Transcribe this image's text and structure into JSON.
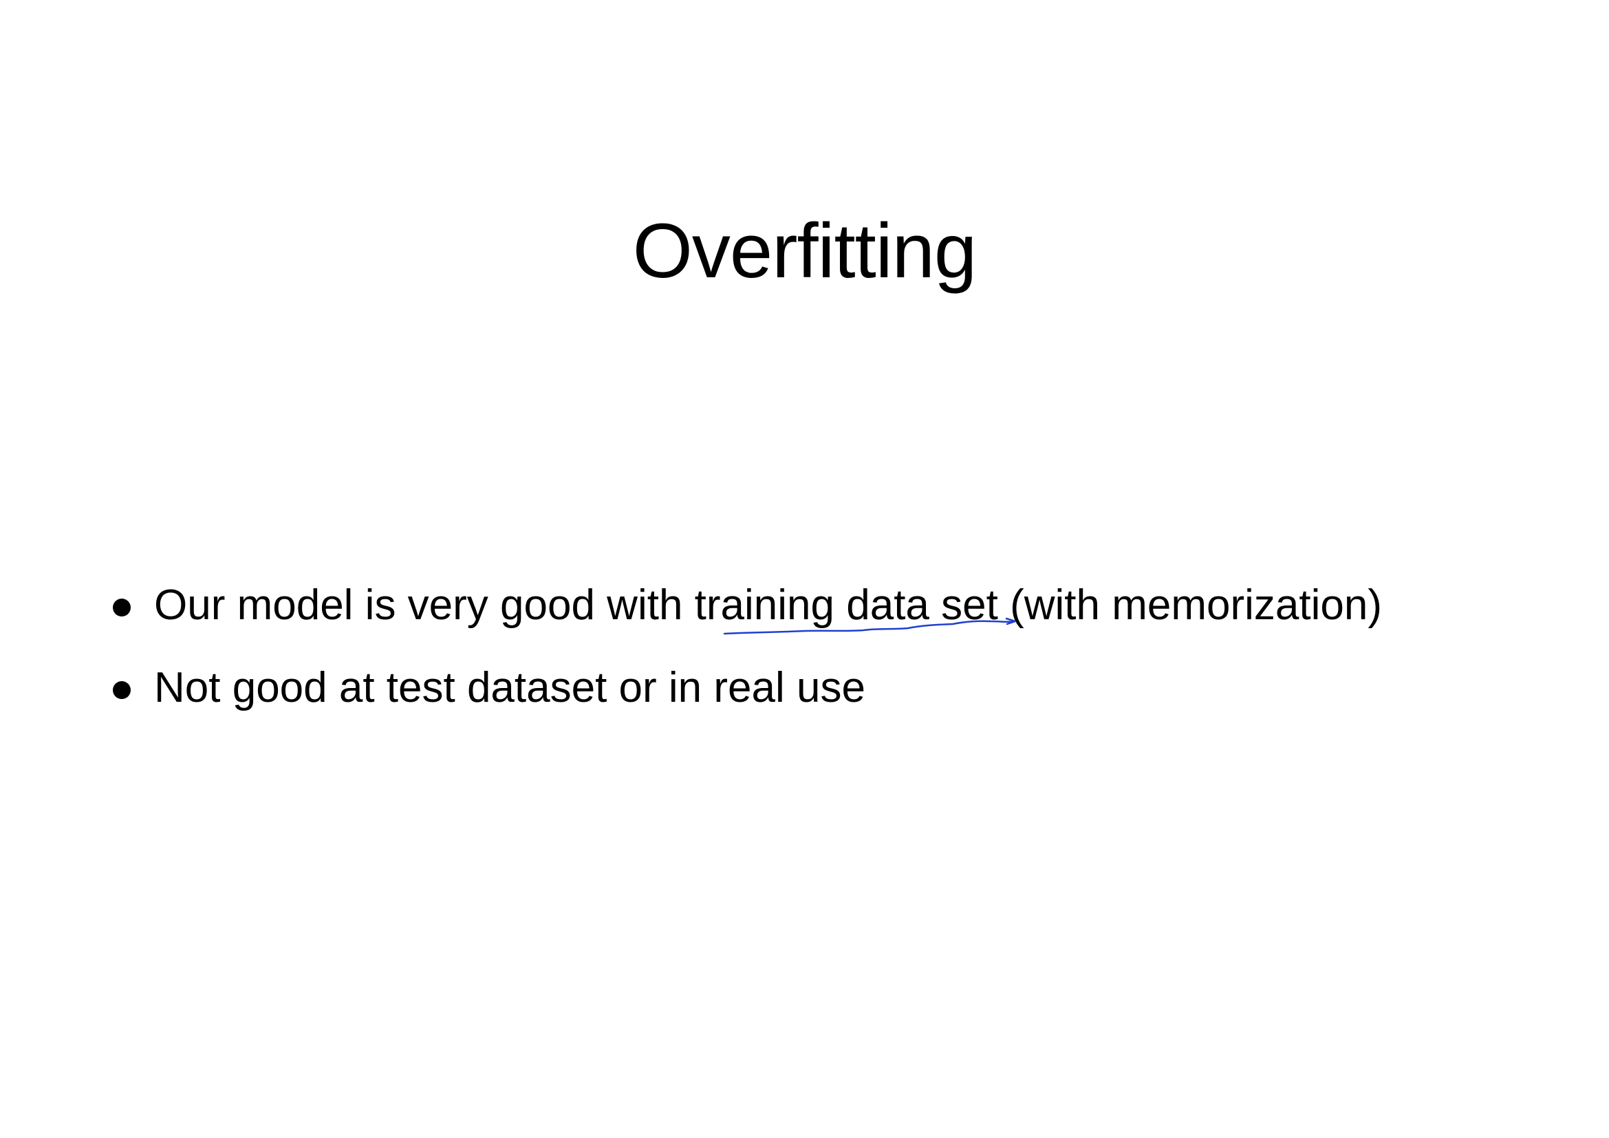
{
  "slide": {
    "title": "Overfitting",
    "bullets": [
      {
        "text_before": "Our model is very good with ",
        "highlighted": "training data set",
        "text_after": " (with memorization)"
      },
      {
        "text_before": "Not good at test dataset or in real use",
        "highlighted": "",
        "text_after": ""
      }
    ]
  },
  "colors": {
    "text": "#000000",
    "background": "#ffffff",
    "annotation_ink": "#1f3fd0"
  },
  "icons": {
    "bullet": "filled-circle-bullet",
    "annotation": "handwritten-underline"
  }
}
